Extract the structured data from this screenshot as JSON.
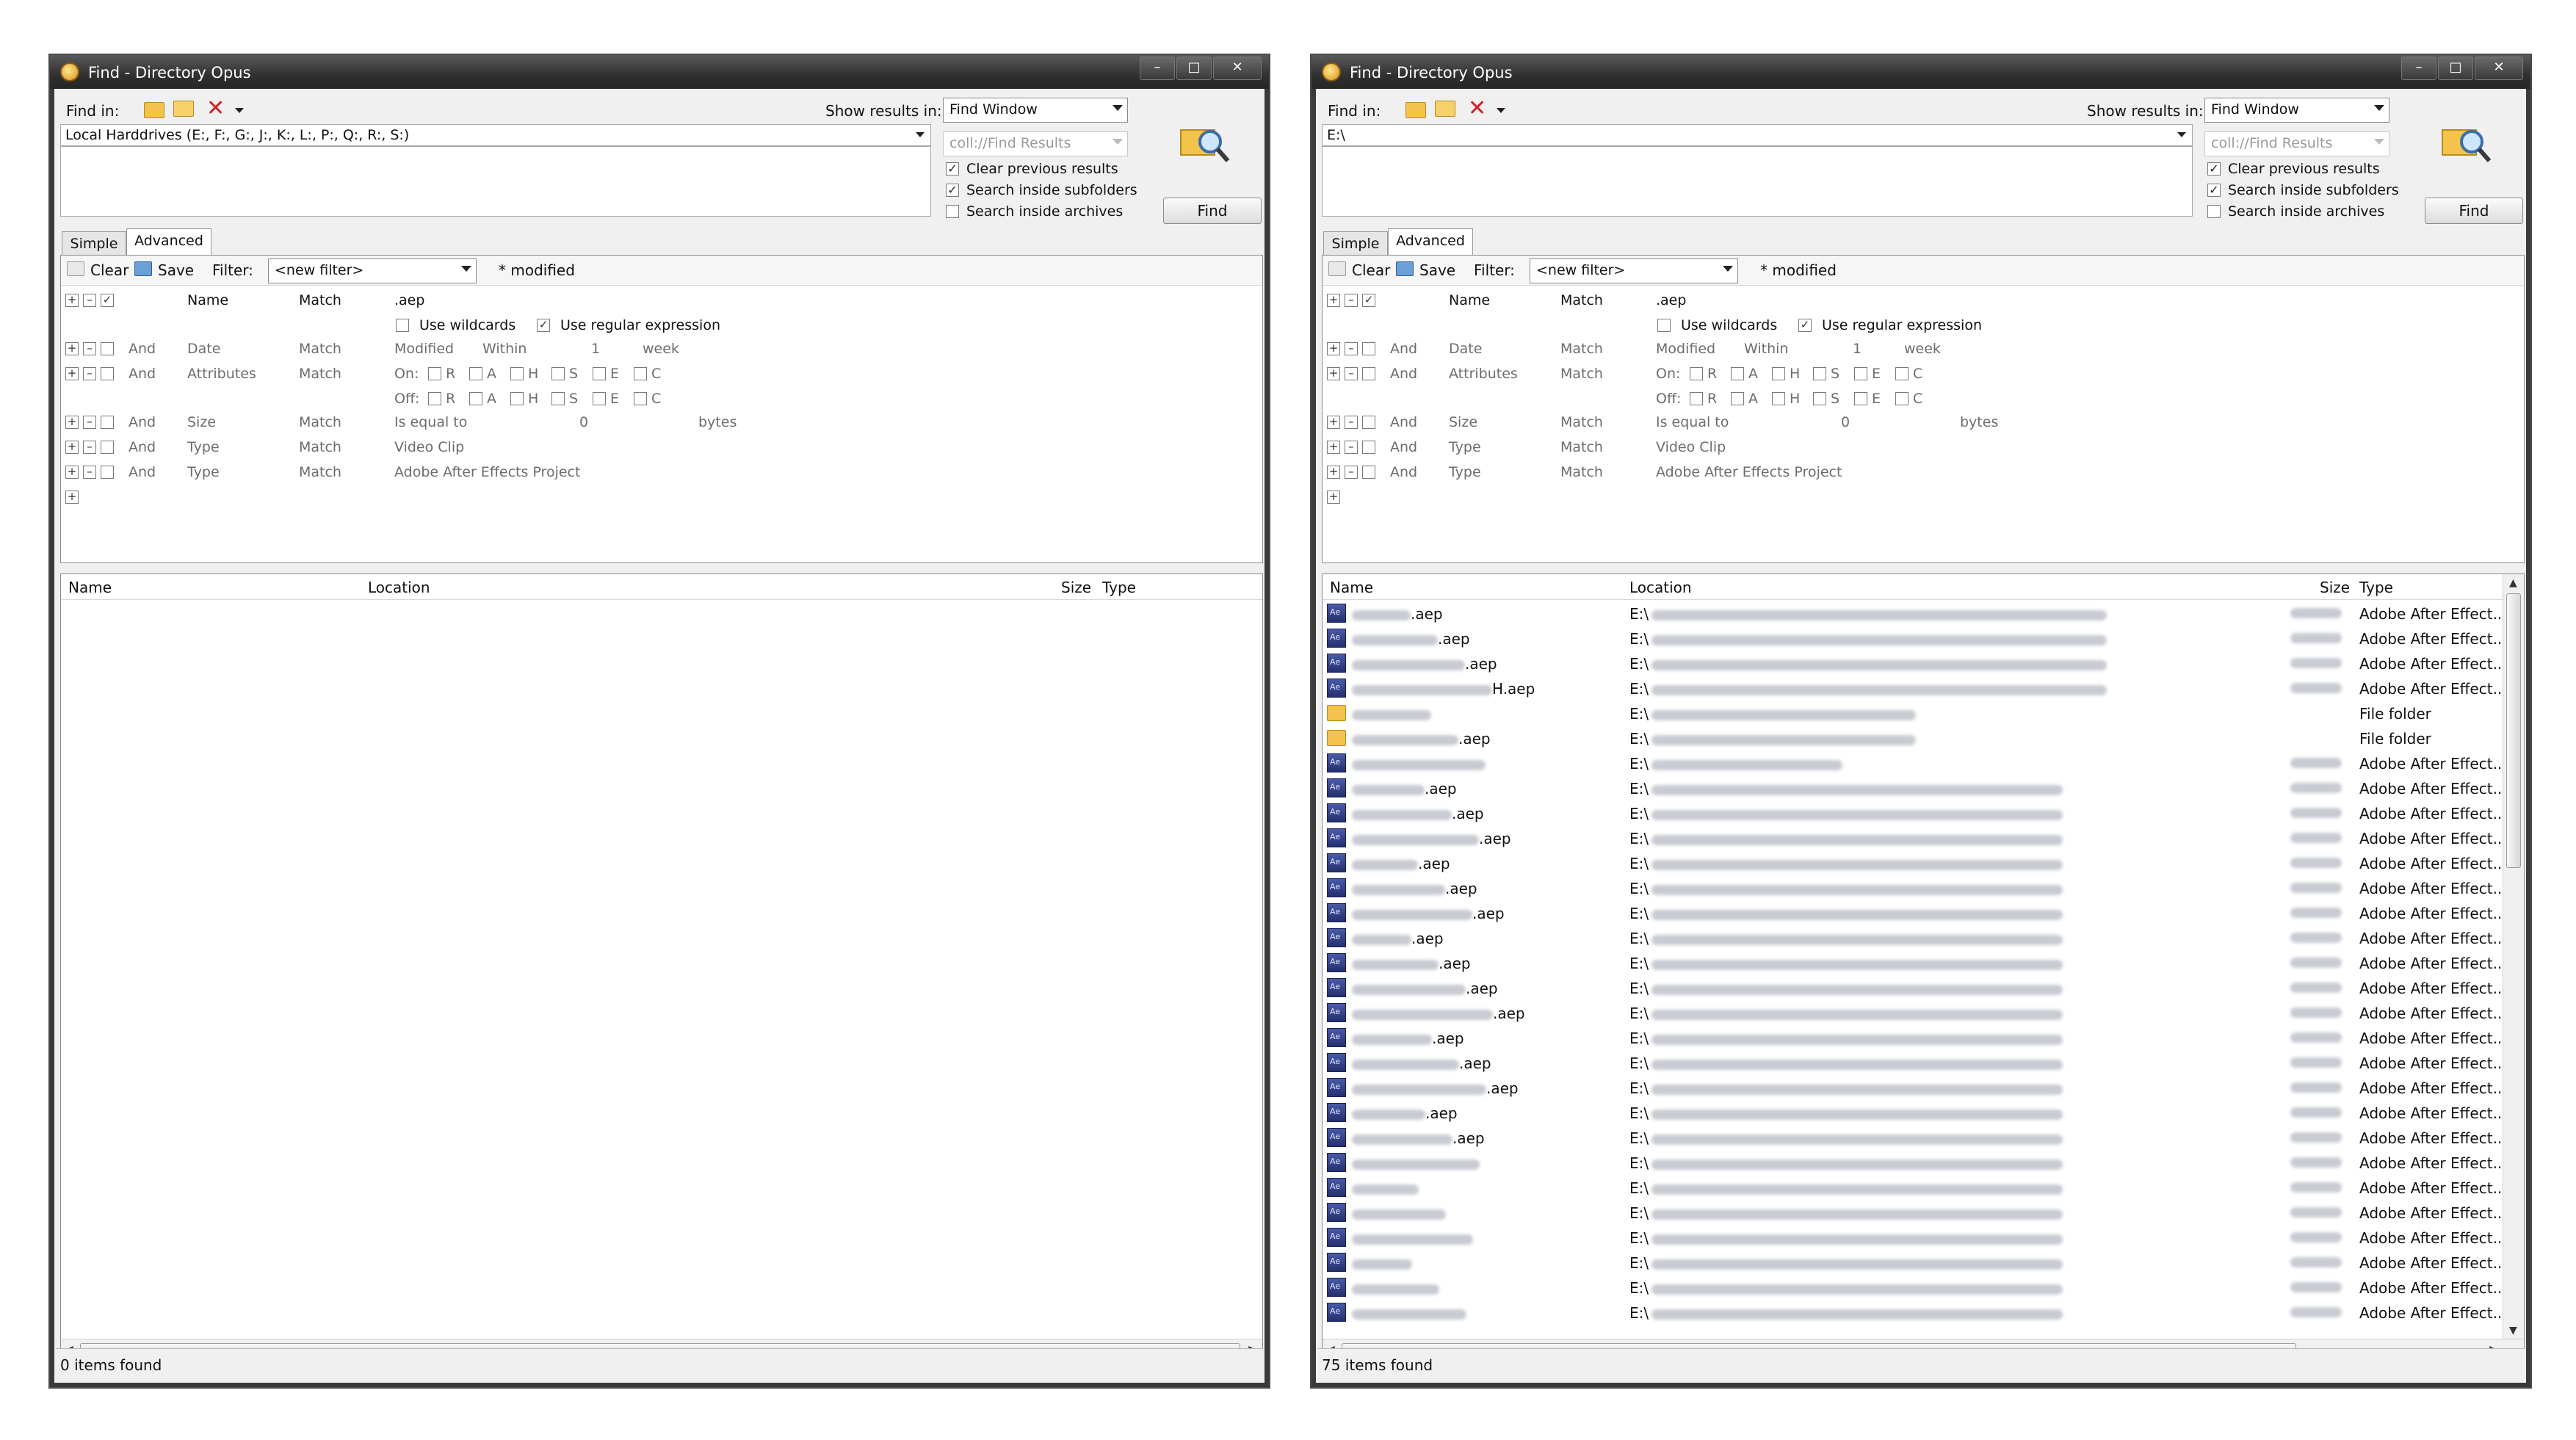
{
  "left": {
    "title": "Find - Directory Opus",
    "find_in_label": "Find in:",
    "find_in_value": "Local Harddrives (E:, F:, G:, J:, K:, L:, P:, Q:, R:, S:)",
    "show_results_label": "Show results in:",
    "show_results_value": "Find Window",
    "coll_value": "coll://Find Results",
    "clear_previous": "Clear previous results",
    "search_subfolders": "Search inside subfolders",
    "search_archives": "Search inside archives",
    "find_button": "Find",
    "tab_simple": "Simple",
    "tab_advanced": "Advanced",
    "toolbar_clear": "Clear",
    "toolbar_save": "Save",
    "filter_label": "Filter:",
    "filter_value": "<new filter>",
    "modified_text": "* modified",
    "col_name": "Name",
    "col_location": "Location",
    "col_size": "Size",
    "col_type": "Type",
    "status": "0 items found"
  },
  "right": {
    "title": "Find - Directory Opus",
    "find_in_label": "Find in:",
    "find_in_value": "E:\\",
    "show_results_label": "Show results in:",
    "show_results_value": "Find Window",
    "coll_value": "coll://Find Results",
    "clear_previous": "Clear previous results",
    "search_subfolders": "Search inside subfolders",
    "search_archives": "Search inside archives",
    "find_button": "Find",
    "tab_simple": "Simple",
    "tab_advanced": "Advanced",
    "toolbar_clear": "Clear",
    "toolbar_save": "Save",
    "filter_label": "Filter:",
    "filter_value": "<new filter>",
    "modified_text": "* modified",
    "col_name": "Name",
    "col_location": "Location",
    "col_size": "Size",
    "col_type": "Type",
    "status": "75 items found",
    "results": [
      {
        "icon": "aep-file-icon",
        "name_suffix": ".aep",
        "location_prefix": "E:\\",
        "type": "Adobe After Effect..."
      },
      {
        "icon": "aep-file-icon",
        "name_suffix": ".aep",
        "location_prefix": "E:\\",
        "type": "Adobe After Effect..."
      },
      {
        "icon": "aep-file-icon",
        "name_suffix": ".aep",
        "location_prefix": "E:\\",
        "type": "Adobe After Effect..."
      },
      {
        "icon": "aep-file-icon",
        "name_suffix": "H.aep",
        "location_prefix": "E:\\",
        "type": "Adobe After Effect..."
      },
      {
        "icon": "folder-icon",
        "name_suffix": "",
        "location_prefix": "E:\\",
        "type": "File folder"
      },
      {
        "icon": "folder-icon",
        "name_suffix": ".aep",
        "location_prefix": "E:\\",
        "type": "File folder"
      },
      {
        "icon": "aep-file-icon",
        "name_suffix": "",
        "location_prefix": "E:\\",
        "type": "Adobe After Effect..."
      },
      {
        "icon": "aep-file-icon",
        "name_suffix": ".aep",
        "location_prefix": "E:\\",
        "type": "Adobe After Effect..."
      },
      {
        "icon": "aep-file-icon",
        "name_suffix": ".aep",
        "location_prefix": "E:\\",
        "type": "Adobe After Effect..."
      },
      {
        "icon": "aep-file-icon",
        "name_suffix": ".aep",
        "location_prefix": "E:\\",
        "type": "Adobe After Effect..."
      },
      {
        "icon": "aep-file-icon",
        "name_suffix": ".aep",
        "location_prefix": "E:\\",
        "type": "Adobe After Effect..."
      },
      {
        "icon": "aep-file-icon",
        "name_suffix": ".aep",
        "location_prefix": "E:\\",
        "type": "Adobe After Effect..."
      },
      {
        "icon": "aep-file-icon",
        "name_suffix": ".aep",
        "location_prefix": "E:\\",
        "type": "Adobe After Effect..."
      },
      {
        "icon": "aep-file-icon",
        "name_suffix": ".aep",
        "location_prefix": "E:\\",
        "type": "Adobe After Effect..."
      },
      {
        "icon": "aep-file-icon",
        "name_suffix": ".aep",
        "location_prefix": "E:\\",
        "type": "Adobe After Effect..."
      },
      {
        "icon": "aep-file-icon",
        "name_suffix": ".aep",
        "location_prefix": "E:\\",
        "type": "Adobe After Effect..."
      },
      {
        "icon": "aep-file-icon",
        "name_suffix": ".aep",
        "location_prefix": "E:\\",
        "type": "Adobe After Effect..."
      },
      {
        "icon": "aep-file-icon",
        "name_suffix": ".aep",
        "location_prefix": "E:\\",
        "type": "Adobe After Effect..."
      },
      {
        "icon": "aep-file-icon",
        "name_suffix": ".aep",
        "location_prefix": "E:\\",
        "type": "Adobe After Effect..."
      },
      {
        "icon": "aep-file-icon",
        "name_suffix": ".aep",
        "location_prefix": "E:\\",
        "type": "Adobe After Effect..."
      },
      {
        "icon": "aep-file-icon",
        "name_suffix": ".aep",
        "location_prefix": "E:\\",
        "type": "Adobe After Effect..."
      },
      {
        "icon": "aep-file-icon",
        "name_suffix": ".aep",
        "location_prefix": "E:\\",
        "type": "Adobe After Effect..."
      },
      {
        "icon": "aep-file-icon",
        "name_suffix": "",
        "location_prefix": "E:\\",
        "type": "Adobe After Effect..."
      },
      {
        "icon": "aep-file-icon",
        "name_suffix": "",
        "location_prefix": "E:\\",
        "type": "Adobe After Effect..."
      },
      {
        "icon": "aep-file-icon",
        "name_suffix": "",
        "location_prefix": "E:\\",
        "type": "Adobe After Effect..."
      },
      {
        "icon": "aep-file-icon",
        "name_suffix": "",
        "location_prefix": "E:\\",
        "type": "Adobe After Effect..."
      },
      {
        "icon": "aep-file-icon",
        "name_suffix": "",
        "location_prefix": "E:\\",
        "type": "Adobe After Effect..."
      },
      {
        "icon": "aep-file-icon",
        "name_suffix": "",
        "location_prefix": "E:\\",
        "type": "Adobe After Effect..."
      },
      {
        "icon": "aep-file-icon",
        "name_suffix": "",
        "location_prefix": "E:\\",
        "type": "Adobe After Effect..."
      }
    ]
  },
  "criteria": {
    "rows": [
      {
        "conj": "",
        "field": "Name",
        "match": "Match",
        "value": ".aep",
        "checked": true
      },
      {
        "conj": "And",
        "field": "Date",
        "match": "Match",
        "value": "Modified",
        "extra1": "Within",
        "extra2": "1",
        "extra3": "week"
      },
      {
        "conj": "And",
        "field": "Attributes",
        "match": "Match",
        "value": "On:",
        "value2": "Off:"
      },
      {
        "conj": "And",
        "field": "Size",
        "match": "Match",
        "value": "Is equal to",
        "extra2": "0",
        "extra3": "bytes"
      },
      {
        "conj": "And",
        "field": "Type",
        "match": "Match",
        "value": "Video Clip"
      },
      {
        "conj": "And",
        "field": "Type",
        "match": "Match",
        "value": "Adobe After Effects Project"
      }
    ],
    "use_wildcards": "Use wildcards",
    "use_regex": "Use regular expression",
    "attr_letters": [
      "R",
      "A",
      "H",
      "S",
      "E",
      "C"
    ]
  },
  "ui_colors": {
    "titlebar": "#2f2f2f",
    "window_bg": "#f0f0f0",
    "close_x": "#d02020",
    "folder": "#f4c34c",
    "aep_icon": "#2a377a"
  }
}
